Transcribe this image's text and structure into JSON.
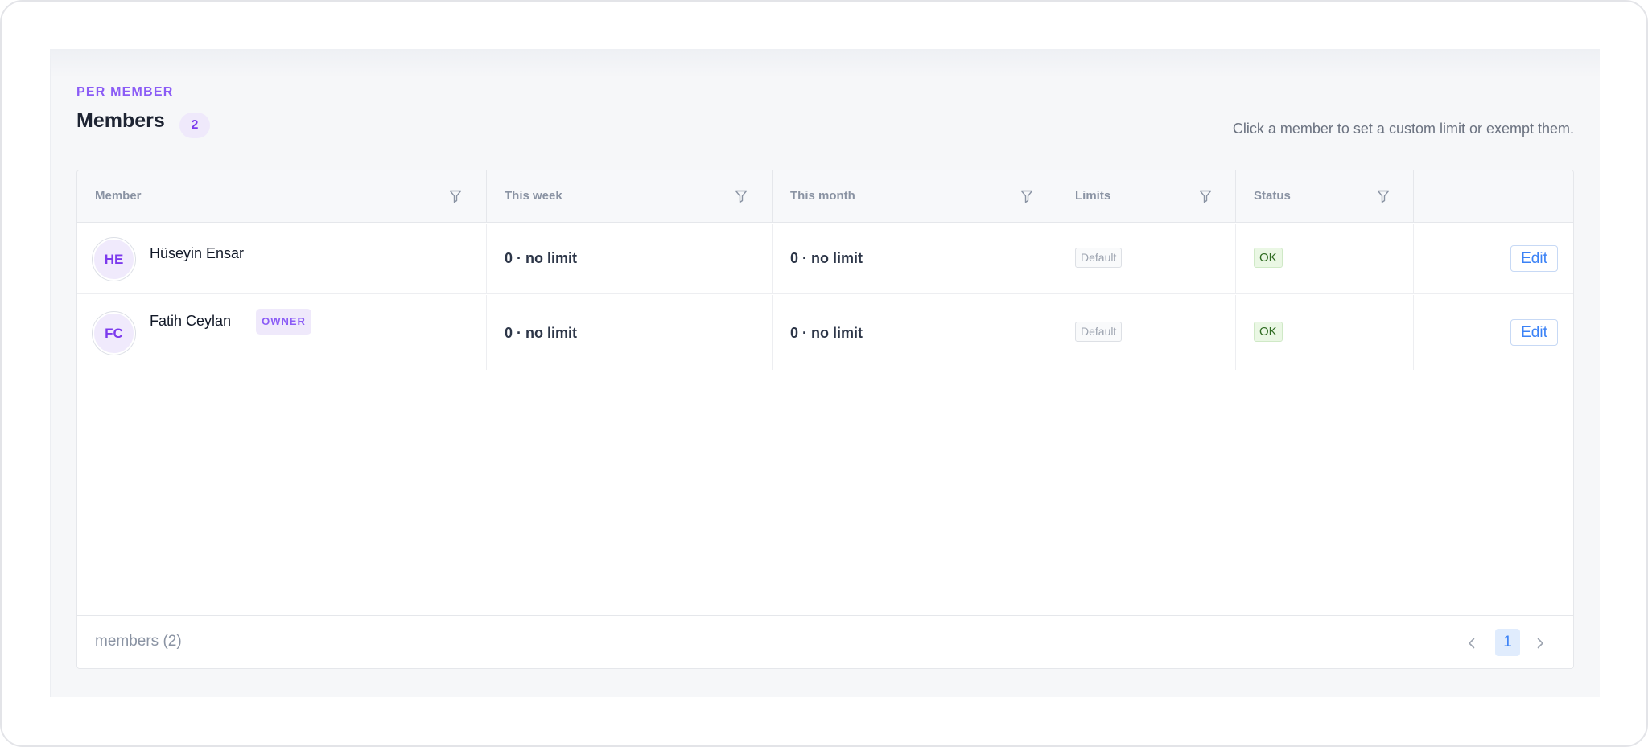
{
  "header": {
    "eyebrow": "PER MEMBER",
    "title": "Members",
    "count": "2",
    "hint": "Click a member to set a custom limit or exempt them."
  },
  "table": {
    "columns": [
      {
        "label": "Member",
        "filter_icon": "filter-icon"
      },
      {
        "label": "This week",
        "filter_icon": "filter-icon"
      },
      {
        "label": "This month",
        "filter_icon": "filter-icon"
      },
      {
        "label": "Limits",
        "filter_icon": "filter-icon"
      },
      {
        "label": "Status",
        "filter_icon": "filter-icon"
      },
      {
        "label": ""
      }
    ],
    "rows": [
      {
        "initials": "HE",
        "name": "Hüseyin Ensar",
        "role_tag": "",
        "this_week": "0 · no limit",
        "this_month": "0 · no limit",
        "limits": "Default",
        "status": "OK",
        "action": "Edit"
      },
      {
        "initials": "FC",
        "name": "Fatih Ceylan",
        "role_tag": "OWNER",
        "this_week": "0 · no limit",
        "this_month": "0 · no limit",
        "limits": "Default",
        "status": "OK",
        "action": "Edit"
      }
    ]
  },
  "footer": {
    "summary": "members (2)",
    "current_page": "1",
    "prev_icon": "chevron-left-icon",
    "next_icon": "chevron-right-icon"
  },
  "colors": {
    "accent_purple": "#8b5cf6",
    "link_blue": "#3b82f6",
    "ok_green_bg": "#eaf7e4"
  }
}
